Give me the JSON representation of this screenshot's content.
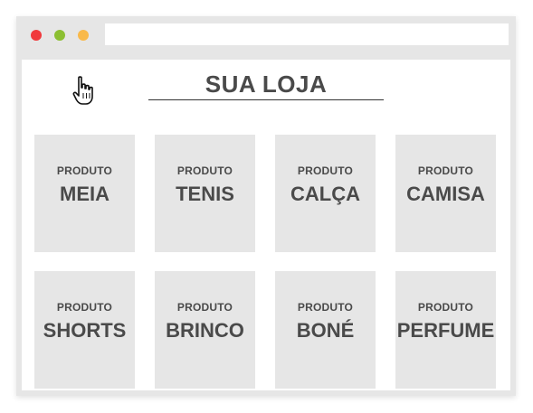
{
  "window": {
    "dots": [
      {
        "name": "close",
        "color": "#f0393c"
      },
      {
        "name": "minimize",
        "color": "#8cbf32"
      },
      {
        "name": "zoom",
        "color": "#f9b94a"
      }
    ]
  },
  "store": {
    "title": "SUA LOJA"
  },
  "products": [
    {
      "kicker": "PRODUTO",
      "name": "MEIA"
    },
    {
      "kicker": "PRODUTO",
      "name": "TENIS"
    },
    {
      "kicker": "PRODUTO",
      "name": "CALÇA"
    },
    {
      "kicker": "PRODUTO",
      "name": "CAMISA"
    },
    {
      "kicker": "PRODUTO",
      "name": "SHORTS"
    },
    {
      "kicker": "PRODUTO",
      "name": "BRINCO"
    },
    {
      "kicker": "PRODUTO",
      "name": "BONÉ"
    },
    {
      "kicker": "PRODUTO",
      "name": "PERFUME"
    }
  ]
}
